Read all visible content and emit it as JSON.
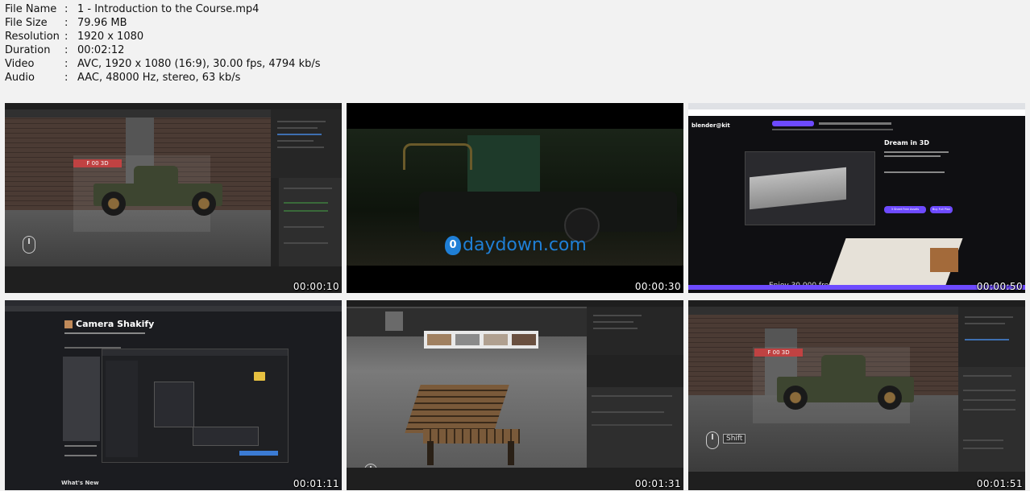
{
  "info": [
    {
      "key": "File Name",
      "value": "1 - Introduction to the Course.mp4"
    },
    {
      "key": "File Size",
      "value": "79.96 MB"
    },
    {
      "key": "Resolution",
      "value": "1920 x 1080"
    },
    {
      "key": "Duration",
      "value": "00:02:12"
    },
    {
      "key": "Video",
      "value": "AVC, 1920 x 1080 (16:9), 30.00 fps, 4794 kb/s"
    },
    {
      "key": "Audio",
      "value": "AAC, 48000 Hz, stereo, 63 kb/s"
    }
  ],
  "separator": ":",
  "thumbnails": [
    {
      "timestamp": "00:00:10"
    },
    {
      "timestamp": "00:00:30",
      "watermark": "daydown.com",
      "watermark_badge": "0"
    },
    {
      "timestamp": "00:00:50",
      "brand": "blender@kit",
      "hero_title": "Dream in 3D",
      "hero_primary_button": "3 Sheet Free Assets",
      "hero_secondary_button": "Buy Full Plan",
      "teaser": "Enjoy 30,000 free"
    },
    {
      "timestamp": "00:01:11",
      "page_title": "Camera Shakify",
      "section_heading": "What's New"
    },
    {
      "timestamp": "00:01:31"
    },
    {
      "timestamp": "00:01:51",
      "key_hint": "Shift"
    }
  ],
  "colors": {
    "background": "#f2f2f2",
    "blender_dark": "#2b2b2b",
    "accent_purple": "#6d4aff",
    "watermark_blue": "#1f7fd6"
  }
}
